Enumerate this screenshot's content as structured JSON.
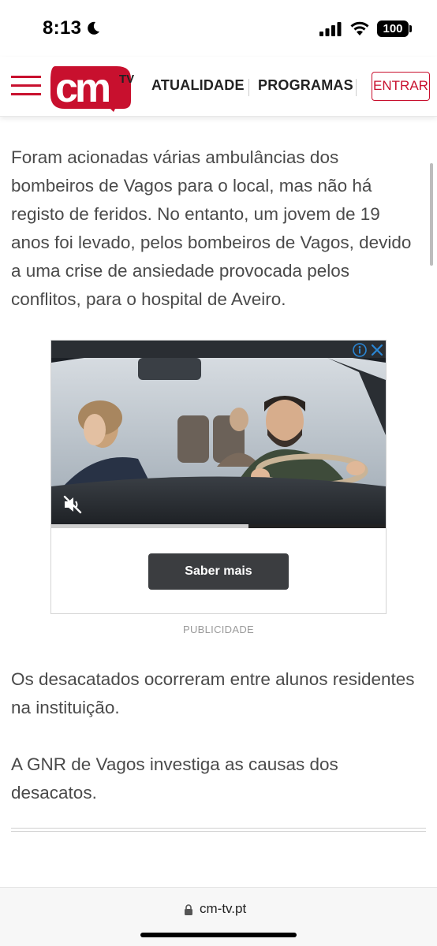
{
  "status_bar": {
    "time": "8:13",
    "battery": "100"
  },
  "header": {
    "logo_text": "cm",
    "logo_suffix": "TV",
    "nav": [
      "ATUALIDADE",
      "PROGRAMAS"
    ],
    "login_label": "ENTRAR",
    "brand_color": "#c8102e"
  },
  "article": {
    "paragraphs": [
      "Foram acionadas várias ambulâncias dos bombeiros de Vagos para o local, mas não há registo de feridos. No entanto, um jovem de 19 anos foi levado, pelos bombeiros de Vagos, devido a uma crise de ansiedade provocada pelos conflitos, para o hospital de Aveiro.",
      "Os desacatados ocorreram entre alunos residentes na instituição.",
      "A GNR de Vagos investiga as causas dos desacatos."
    ]
  },
  "ad": {
    "cta_label": "Saber mais",
    "label": "PUBLICIDADE",
    "video_progress": 0.59
  },
  "browser": {
    "url": "cm-tv.pt"
  }
}
